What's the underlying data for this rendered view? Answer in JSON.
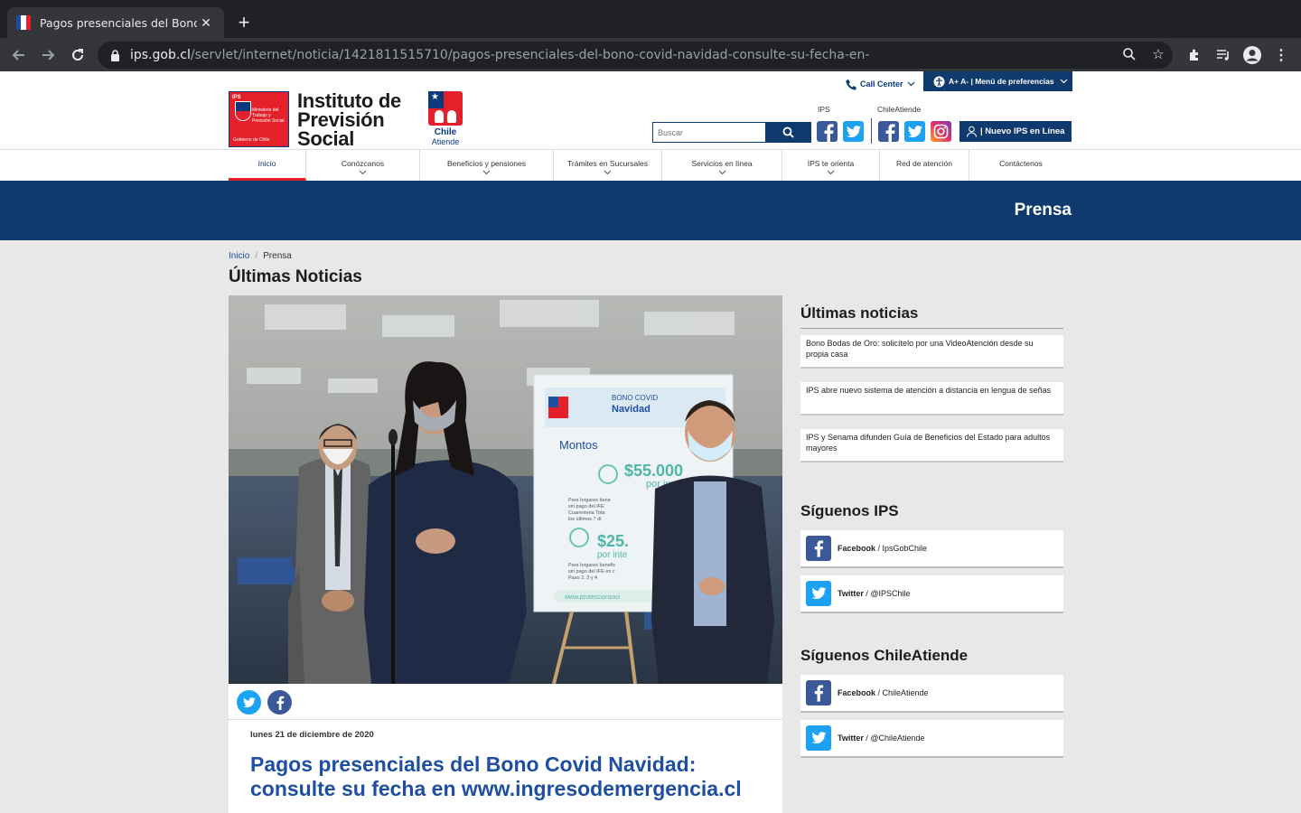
{
  "browser": {
    "tab_title": "Pagos presenciales del Bono C",
    "url_domain": "ips.gob.cl",
    "url_path": "/servlet/internet/noticia/1421811515710/pagos-presenciales-del-bono-covid-navidad-consulte-su-fecha-en-"
  },
  "header": {
    "ips_logo_small": "IPS",
    "ips_logo_ministry": "Ministerio del Trabajo y Previsión Social",
    "ips_logo_gobierno": "Gobierno de Chile",
    "ips_name_line1": "Instituto de",
    "ips_name_line2": "Previsión",
    "ips_name_line3": "Social",
    "ca_line1": "Chile",
    "ca_line2": "Atiende",
    "call_center": "Call Center",
    "prefs": "A+ A- | Menú de preferencias",
    "label_ips": "IPS",
    "label_ca": "ChileAtiende",
    "search_placeholder": "Buscar",
    "nuevo_ips": "| Nuevo IPS en Línea"
  },
  "menu": {
    "items": [
      {
        "label": "Inicio"
      },
      {
        "label": "Conózcanos"
      },
      {
        "label": "Beneficios y pensiones"
      },
      {
        "label": "Trámites en Sucursales"
      },
      {
        "label": "Servicios en línea"
      },
      {
        "label": "IPS te orienta"
      },
      {
        "label": "Red de atención"
      },
      {
        "label": "Contáctenos"
      }
    ]
  },
  "banner": {
    "title": "Prensa"
  },
  "breadcrumb": {
    "home": "Inicio",
    "sep": "/",
    "current": "Prensa"
  },
  "page_title": "Últimas Noticias",
  "article": {
    "date": "lunes 21 de diciembre de 2020",
    "headline": "Pagos presenciales del Bono Covid Navidad: consulte su fecha en www.ingresodemergencia.cl",
    "poster": {
      "brand": "BONO COVID",
      "brand2": "Navidad",
      "montos": "Montos",
      "amount1": "$55.000",
      "amount1_sub": "por in",
      "amount2": "$25.",
      "amount2_sub": "por inte",
      "text1": "Para hogares bene\nsin pago del IFE\nCuarentena Tota\nlos últimos 7 dí",
      "text2": "Para hogares benefic\nsin pago del IFE en c\nPaso 2, 3 y 4",
      "url": "www.proteccionsoci"
    }
  },
  "sidebar": {
    "latest_title": "Últimas noticias",
    "latest": [
      {
        "text": "Bono Bodas de Oro: solicítelo por una VideoAtención desde su propia casa"
      },
      {
        "text": "IPS abre nuevo sistema de atención a distancia en lengua de señas"
      },
      {
        "text": "IPS y Senama difunden Guía de Beneficios del Estado para adultos mayores"
      }
    ],
    "follow_ips_title": "Síguenos IPS",
    "follow_ips": [
      {
        "network": "Facebook",
        "handle": " / IpsGobChile"
      },
      {
        "network": "Twitter",
        "handle": " / @IPSChile"
      }
    ],
    "follow_ca_title": "Síguenos ChileAtiende",
    "follow_ca": [
      {
        "network": "Facebook",
        "handle": " / ChileAtiende"
      },
      {
        "network": "Twitter",
        "handle": " / @ChileAtiende"
      }
    ]
  },
  "colors": {
    "navy": "#0f3a6e",
    "red": "#e4202b",
    "link_blue": "#1f4fa0",
    "facebook": "#3b5998",
    "twitter": "#1da1f2"
  }
}
